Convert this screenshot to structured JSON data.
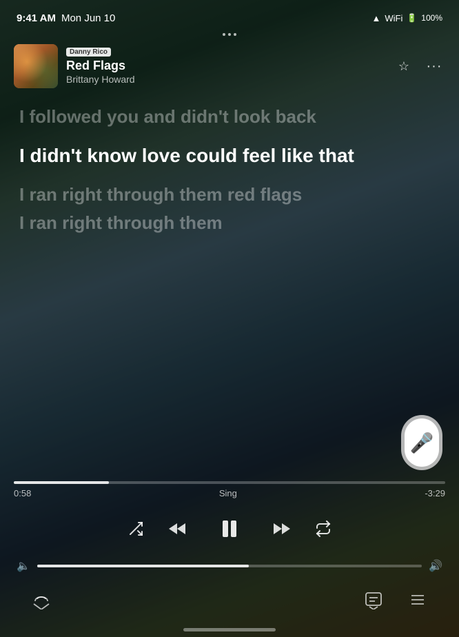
{
  "status": {
    "time": "9:41 AM",
    "date": "Mon Jun 10",
    "wifi": "100%"
  },
  "track": {
    "user": "Danny Rico",
    "title": "Red Flags",
    "artist": "Brittany Howard"
  },
  "lyrics": {
    "previous": "I followed you and didn't look back",
    "active_part1": "I didn't know love ",
    "active_part2": "could feel like that",
    "future1": "I ran right through them red flags",
    "future2": "I ran right through them"
  },
  "progress": {
    "elapsed": "0:58",
    "label": "Sing",
    "remaining": "-3:29",
    "percent": 22
  },
  "volume": {
    "percent": 55
  },
  "controls": {
    "shuffle": "⇄",
    "rewind": "⏮",
    "pause": "⏸",
    "forward": "⏭",
    "repeat": "↺"
  },
  "header": {
    "user_badge": "Danny Rico",
    "star_icon": "☆",
    "more_icon": "···"
  },
  "bottom": {
    "airplay": "⊙",
    "lyrics": "💬",
    "queue": "≡"
  }
}
